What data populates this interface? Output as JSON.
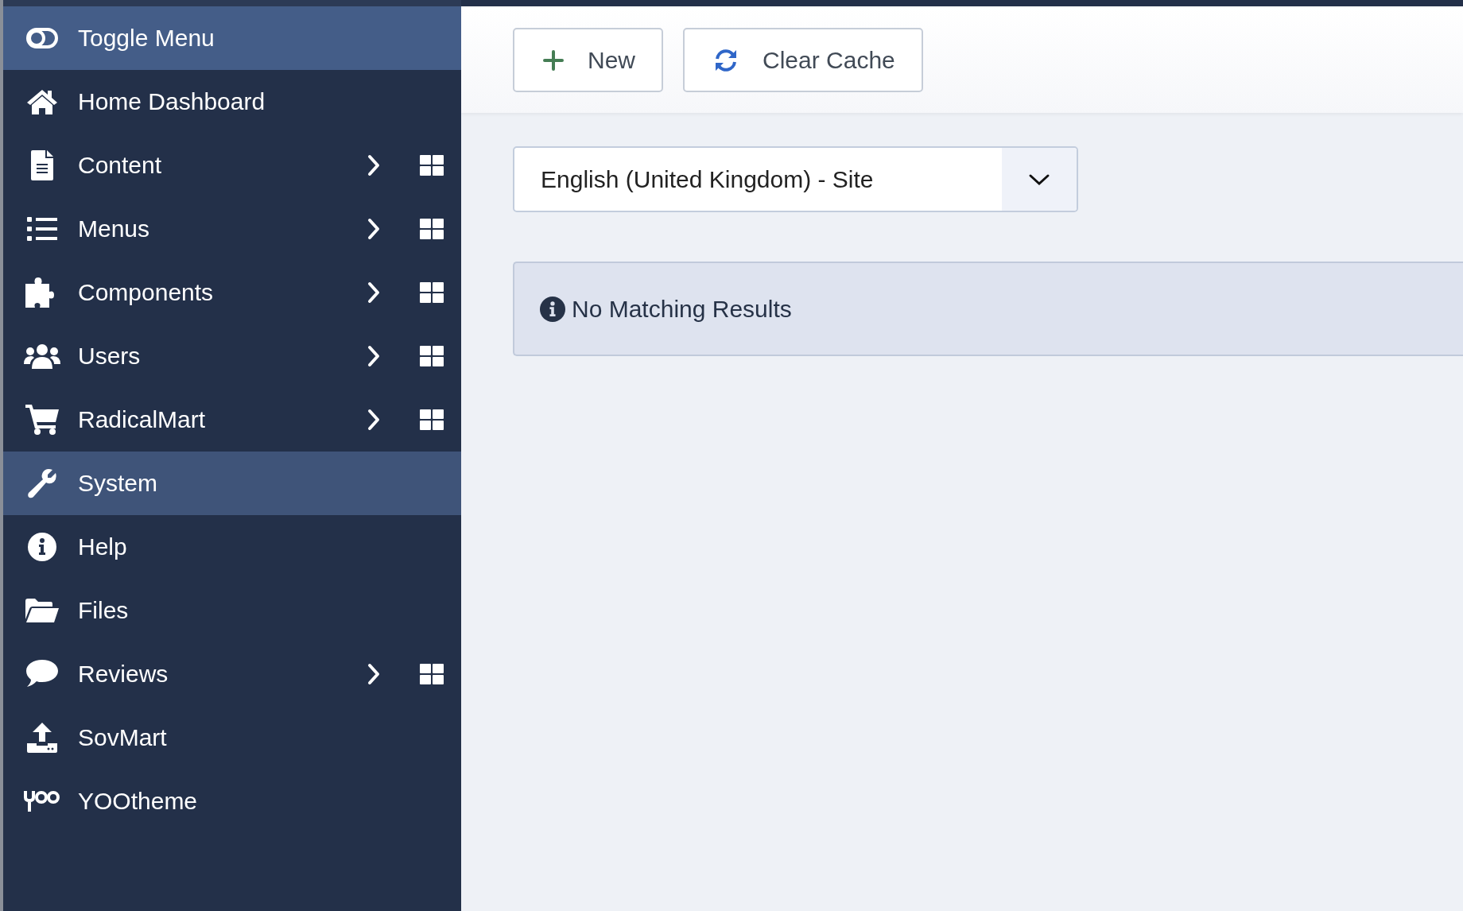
{
  "sidebar": {
    "toggle": {
      "label": "Toggle Menu"
    },
    "items": [
      {
        "label": "Home Dashboard",
        "selected": false,
        "expandable": false
      },
      {
        "label": "Content",
        "selected": false,
        "expandable": true
      },
      {
        "label": "Menus",
        "selected": false,
        "expandable": true
      },
      {
        "label": "Components",
        "selected": false,
        "expandable": true
      },
      {
        "label": "Users",
        "selected": false,
        "expandable": true
      },
      {
        "label": "RadicalMart",
        "selected": false,
        "expandable": true
      },
      {
        "label": "System",
        "selected": true,
        "expandable": false
      },
      {
        "label": "Help",
        "selected": false,
        "expandable": false
      },
      {
        "label": "Files",
        "selected": false,
        "expandable": false
      },
      {
        "label": "Reviews",
        "selected": false,
        "expandable": true
      },
      {
        "label": "SovMart",
        "selected": false,
        "expandable": false
      },
      {
        "label": "YOOtheme",
        "selected": false,
        "expandable": false
      }
    ]
  },
  "toolbar": {
    "buttons": [
      {
        "label": "New",
        "kind": "new"
      },
      {
        "label": "Clear Cache",
        "kind": "refresh"
      }
    ]
  },
  "filter": {
    "value": "English (United Kingdom) - Site"
  },
  "alert": {
    "text": "No Matching Results"
  }
}
